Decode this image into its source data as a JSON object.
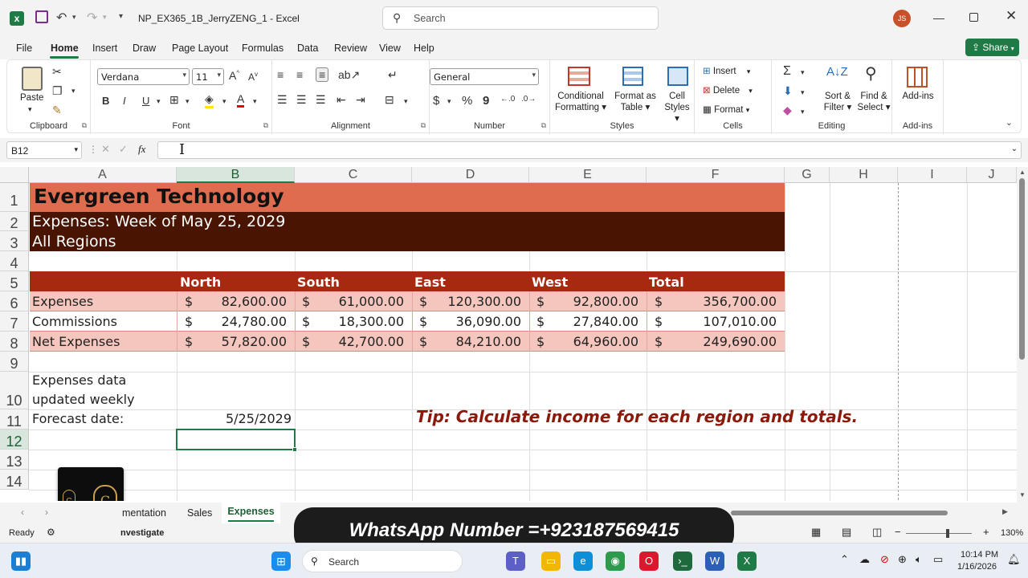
{
  "titlebar": {
    "filename": "NP_EX365_1B_JerryZENG_1",
    "separator": "-",
    "app": "Excel",
    "search_placeholder": "Search",
    "user_initials": "JS"
  },
  "menu": [
    "File",
    "Home",
    "Insert",
    "Draw",
    "Page Layout",
    "Formulas",
    "Data",
    "Review",
    "View",
    "Help"
  ],
  "share_label": "Share",
  "ribbon": {
    "clipboard": {
      "paste": "Paste",
      "label": "Clipboard"
    },
    "font": {
      "name": "Verdana",
      "size": "11",
      "bold": "B",
      "italic": "I",
      "underline": "U",
      "label": "Font"
    },
    "alignment": {
      "label": "Alignment"
    },
    "number": {
      "format": "General",
      "currency": "$",
      "percent": "%",
      "comma": "9",
      "label": "Number"
    },
    "styles": {
      "conditional": "Conditional",
      "formatting": "Formatting",
      "format_as": "Format as",
      "table": "Table",
      "cell": "Cell",
      "cell_styles": "Styles",
      "label": "Styles"
    },
    "cells": {
      "insert": "Insert",
      "delete": "Delete",
      "format": "Format",
      "label": "Cells"
    },
    "editing": {
      "sort": "Sort &",
      "filter": "Filter",
      "find": "Find &",
      "select": "Select",
      "label": "Editing"
    },
    "addins": {
      "btn": "Add-ins",
      "label": "Add-ins"
    }
  },
  "formula_bar": {
    "name_box": "B12",
    "fx": "fx",
    "content": ""
  },
  "columns": [
    "A",
    "B",
    "C",
    "D",
    "E",
    "F",
    "G",
    "H",
    "I",
    "J"
  ],
  "rows": [
    "1",
    "2",
    "3",
    "4",
    "5",
    "6",
    "7",
    "8",
    "9",
    "10",
    "11",
    "12",
    "13",
    "14"
  ],
  "sheet": {
    "title": "Evergreen Technology",
    "subtitle": "Expenses: Week of May 25, 2029",
    "region": "All Regions",
    "headers": [
      "North",
      "South",
      "East",
      "West",
      "Total"
    ],
    "currency_symbol": "$",
    "data_rows": [
      {
        "label": "Expenses",
        "values": [
          "82,600.00",
          "61,000.00",
          "120,300.00",
          "92,800.00",
          "356,700.00"
        ]
      },
      {
        "label": "Commissions",
        "values": [
          "24,780.00",
          "18,300.00",
          "36,090.00",
          "27,840.00",
          "107,010.00"
        ]
      },
      {
        "label": "Net Expenses",
        "values": [
          "57,820.00",
          "42,700.00",
          "84,210.00",
          "64,960.00",
          "249,690.00"
        ]
      }
    ],
    "note_line1": "Expenses data",
    "note_line2": "updated weekly",
    "forecast_label": "Forecast date:",
    "forecast_value": "5/25/2029",
    "tip": "Tip: Calculate income for each region and totals."
  },
  "sheet_tabs": [
    "mentation",
    "Sales",
    "Expenses"
  ],
  "active_tab": "Expenses",
  "status": {
    "ready": "Ready",
    "investigate": "nvestigate",
    "zoom": "130%"
  },
  "overlay": {
    "whatsapp": "WhatsApp Number =+923187569415"
  },
  "taskbar": {
    "search": "Search",
    "time": "10:14 PM",
    "date": "1/16/2026"
  },
  "colors": {
    "title_bg": "#e06c4f",
    "subtitle_bg": "#4a1402",
    "header_bg": "#a7290f",
    "band_bg": "#f4c6bd",
    "tip": "#8b1a0c",
    "excel_green": "#1f7a45"
  }
}
